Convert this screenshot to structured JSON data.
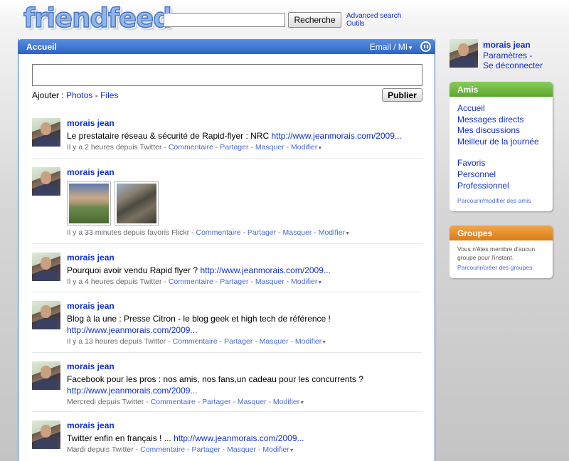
{
  "header": {
    "logo_text": "friendfeed",
    "search_button": "Recherche",
    "advanced_search": "Advanced search",
    "tools": "Outils"
  },
  "main": {
    "title": "Accueil",
    "email_im": "Email / MI",
    "add_label": "Ajouter :",
    "add_photos": "Photos",
    "add_separator": " - ",
    "add_files": "Files",
    "publish_button": "Publier"
  },
  "common": {
    "comment": "Commentaire",
    "share": "Partager",
    "hide": "Masquer",
    "modify": "Modifier",
    "sep": " - "
  },
  "entries": [
    {
      "author": "morais jean",
      "text": "Le prestataire réseau & sécurité de Rapid-flyer : NRC ",
      "link": "http://www.jeanmorais.com/2009...",
      "meta": "Il y a 2 heures depuis Twitter"
    },
    {
      "author": "morais jean",
      "meta": "Il y a 33 minutes depuis favoris Flickr"
    },
    {
      "author": "morais jean",
      "text": "Pourquoi avoir vendu Rapid flyer ? ",
      "link": "http://www.jeanmorais.com/2009...",
      "meta": "Il y a 4 heures depuis Twitter"
    },
    {
      "author": "morais jean",
      "text": "Blog à la une : Presse Citron - le blog geek et high tech de référence ! ",
      "link": "http://www.jeanmorais.com/2009...",
      "meta": "Il y a 13 heures depuis Twitter"
    },
    {
      "author": "morais jean",
      "text": "Facebook pour les pros : nos amis, nos fans,un cadeau pour les concurrents ? ",
      "link": "http://www.jeanmorais.com/2009...",
      "meta": "Mercredi depuis Twitter"
    },
    {
      "author": "morais jean",
      "text": "Twitter enfin en français ! ... ",
      "link": "http://www.jeanmorais.com/2009...",
      "meta": "Mardi depuis Twitter"
    }
  ],
  "sidebar": {
    "user_name": "morais jean",
    "settings": "Paramètres -",
    "logout": "Se déconnecter",
    "friends": {
      "title": "Amis",
      "items": [
        "Accueil",
        "Messages directs",
        "Mes discussions",
        "Meilleur de la journée"
      ],
      "items2": [
        "Favoris",
        "Personnel",
        "Professionnel"
      ],
      "footer": "Parcourir/modifier des amis"
    },
    "groups": {
      "title": "Groupes",
      "text": "Vous n'êtes membre d'aucun groupe pour l'instant.",
      "footer": "Parcourir/créer des groupes"
    }
  }
}
